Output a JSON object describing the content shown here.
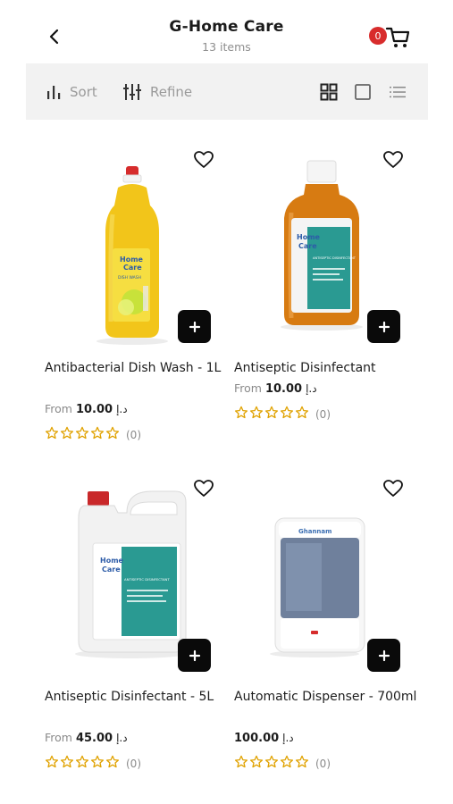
{
  "header": {
    "title": "G-Home Care",
    "subtitle": "13 items",
    "cart_count": "0"
  },
  "toolbar": {
    "sort_label": "Sort",
    "refine_label": "Refine"
  },
  "products": [
    {
      "name": "Antibacterial Dish Wash - 1L",
      "price_prefix": "From",
      "price": "10.00",
      "currency": "د.إ",
      "rating_count": "(0)",
      "stars": 0
    },
    {
      "name": "Antiseptic Disinfectant",
      "price_prefix": "From",
      "price": "10.00",
      "currency": "د.إ",
      "rating_count": "(0)",
      "stars": 0
    },
    {
      "name": "Antiseptic Disinfectant - 5L",
      "price_prefix": "From",
      "price": "45.00",
      "currency": "د.إ",
      "rating_count": "(0)",
      "stars": 0
    },
    {
      "name": "Automatic Dispenser - 700ml",
      "price_prefix": "",
      "price": "100.00",
      "currency": "د.إ",
      "rating_count": "(0)",
      "stars": 0
    }
  ],
  "product_images": [
    {
      "label_line1": "Home",
      "label_line2": "Care",
      "sub": "DISH WASH"
    },
    {
      "label_line1": "Home",
      "label_line2": "Care",
      "sub": "ANTISEPTIC DISINFECTANT"
    },
    {
      "label_line1": "Home",
      "label_line2": "Care",
      "sub": "ANTISEPTIC DISINFECTANT"
    },
    {
      "label_line1": "Ghannam",
      "label_line2": "",
      "sub": ""
    }
  ],
  "colors": {
    "star": "#e0a200",
    "badge": "#d82c2c",
    "add_button": "#0a0a0a",
    "toolbar_bg": "#f2f2f2"
  },
  "icons": [
    "back-chevron-icon",
    "cart-icon",
    "sort-icon",
    "refine-icon",
    "grid-view-icon",
    "single-view-icon",
    "list-view-icon",
    "heart-icon",
    "plus-icon",
    "star-icon"
  ]
}
